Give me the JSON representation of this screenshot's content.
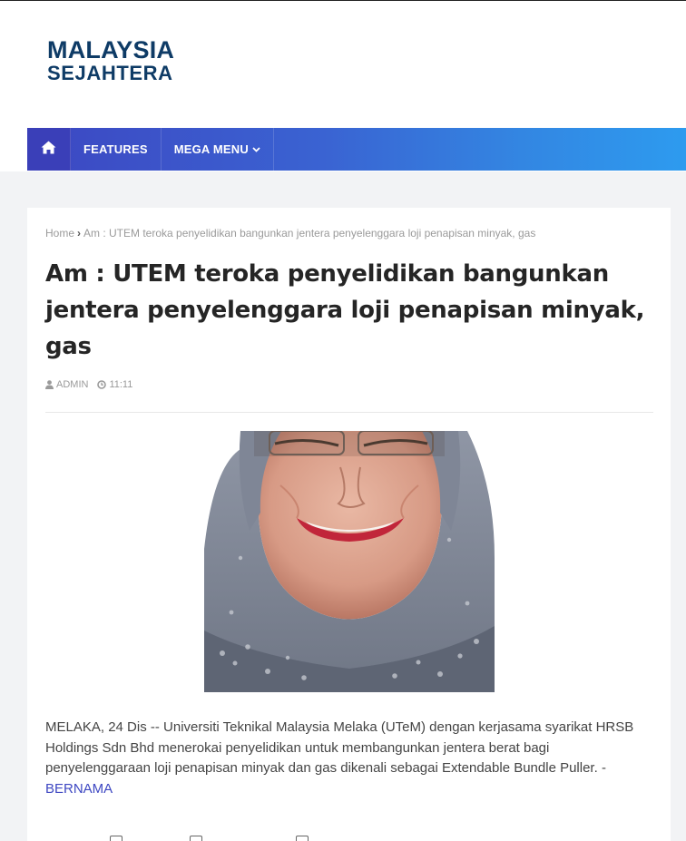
{
  "site": {
    "logo_line1": "MALAYSIA",
    "logo_line2": "SEJAHTERA"
  },
  "nav": {
    "home_icon": "home-icon",
    "items": [
      {
        "label": "FEATURES"
      },
      {
        "label": "MEGA MENU"
      }
    ],
    "mega_menu_icon": "chevron-down-icon"
  },
  "breadcrumb": {
    "home": "Home",
    "current": "Am : UTEM teroka penyelidikan bangunkan jentera penyelenggara loji penapisan minyak, gas"
  },
  "post": {
    "title": "Am : UTEM teroka penyelidikan bangunkan jentera penyelenggara loji penapisan minyak, gas",
    "author": "ADMIN",
    "time": "11:11",
    "author_icon": "user-icon",
    "time_icon": "clock-icon",
    "body": "MELAKA, 24 Dis -- Universiti Teknikal Malaysia Melaka (UTeM) dengan kerjasama syarikat HRSB Holdings Sdn Bhd menerokai penyelidikan untuk membangunkan jentera berat bagi penyelenggaraan loji penapisan minyak dan gas dikenali sebagai Extendable Bundle Puller.",
    "source_prefix": " -",
    "source_link": "BERNAMA"
  },
  "colors": {
    "brand": "#0e3b66",
    "nav_start": "#3d47c2",
    "nav_end": "#2d9bef",
    "link": "#3d47c2"
  }
}
